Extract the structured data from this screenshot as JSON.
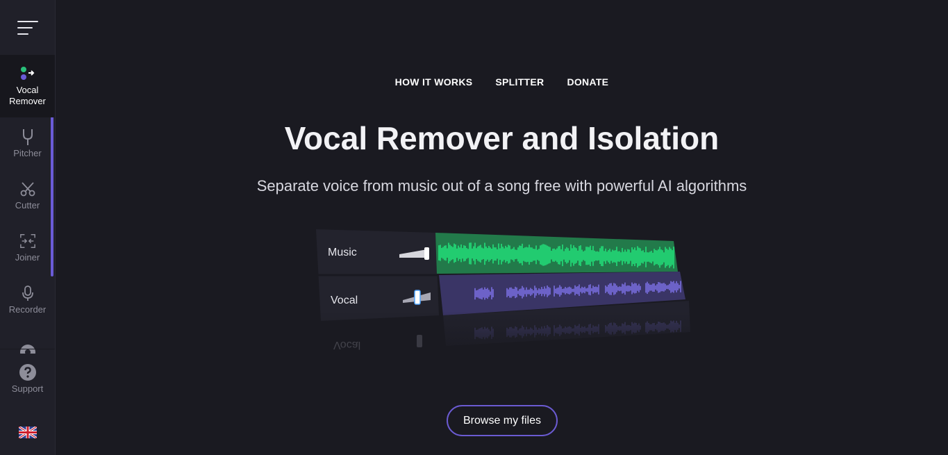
{
  "sidebar": {
    "items": [
      {
        "label": "Vocal Remover",
        "icon": "vocal-remover-icon",
        "active": true
      },
      {
        "label": "Pitcher",
        "icon": "tuning-fork-icon"
      },
      {
        "label": "Cutter",
        "icon": "scissors-icon"
      },
      {
        "label": "Joiner",
        "icon": "joiner-icon"
      },
      {
        "label": "Recorder",
        "icon": "microphone-icon"
      }
    ],
    "support_label": "Support",
    "language": "en-gb-flag-icon"
  },
  "topnav": {
    "how_it_works": "HOW IT WORKS",
    "splitter": "SPLITTER",
    "donate": "DONATE"
  },
  "hero": {
    "title": "Vocal Remover and Isolation",
    "subtitle": "Separate voice from music out of a song free with powerful AI algorithms"
  },
  "mixer": {
    "track_music": "Music",
    "track_vocal": "Vocal",
    "reflection_label": "Vocal"
  },
  "browse_label": "Browse my files",
  "colors": {
    "accent": "#6b5bd2",
    "music_wave": "#22e07a",
    "vocal_wave": "#7a6ee0",
    "background": "#1a1a21"
  }
}
